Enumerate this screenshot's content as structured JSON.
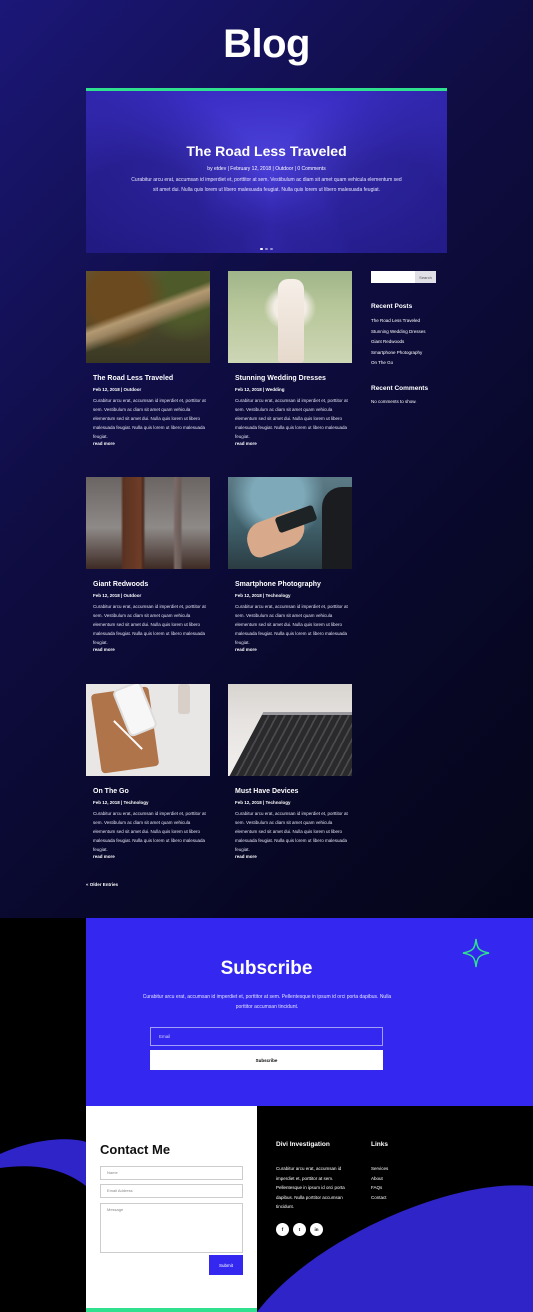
{
  "page": {
    "title": "Blog"
  },
  "slider": {
    "title": "The Road Less Traveled",
    "meta": "by etdev | February 12, 2018 | Outdoor | 0 Comments",
    "excerpt": "Curabitur arcu erat, accumsan id imperdiet et, porttitor at sem. Vestibulum ac diam sit amet quam vehicula elementum sed sit amet dui. Nulla quis lorem ut libero malesuada feugiat. Nulla quis lorem ut libero malesuada feugiat.",
    "dots": 3,
    "active_dot": 1
  },
  "posts": [
    {
      "title": "The Road Less Traveled",
      "meta": "Feb 12, 2018 | Outdoor",
      "excerpt": "Curabitur arcu erat, accumsan id imperdiet et, porttitor at sem. Vestibulum ac diam sit amet quam vehicula elementum sed sit amet dui. Nulla quis lorem ut libero malesuada feugiat. Nulla quis lorem ut libero malesuada feugiat.",
      "read_more": "read more"
    },
    {
      "title": "Stunning Wedding Dresses",
      "meta": "Feb 12, 2018 | Wedding",
      "excerpt": "Curabitur arcu erat, accumsan id imperdiet et, porttitor at sem. Vestibulum ac diam sit amet quam vehicula elementum sed sit amet dui. Nulla quis lorem ut libero malesuada feugiat. Nulla quis lorem ut libero malesuada feugiat.",
      "read_more": "read more"
    },
    {
      "title": "Giant Redwoods",
      "meta": "Feb 12, 2018 | Outdoor",
      "excerpt": "Curabitur arcu erat, accumsan id imperdiet et, porttitor at sem. Vestibulum ac diam sit amet quam vehicula elementum sed sit amet dui. Nulla quis lorem ut libero malesuada feugiat. Nulla quis lorem ut libero malesuada feugiat.",
      "read_more": "read more"
    },
    {
      "title": "Smartphone Photography",
      "meta": "Feb 12, 2018 | Technology",
      "excerpt": "Curabitur arcu erat, accumsan id imperdiet et, porttitor at sem. Vestibulum ac diam sit amet quam vehicula elementum sed sit amet dui. Nulla quis lorem ut libero malesuada feugiat. Nulla quis lorem ut libero malesuada feugiat.",
      "read_more": "read more"
    },
    {
      "title": "On The Go",
      "meta": "Feb 12, 2018 | Technology",
      "excerpt": "Curabitur arcu erat, accumsan id imperdiet et, porttitor at sem. Vestibulum ac diam sit amet quam vehicula elementum sed sit amet dui. Nulla quis lorem ut libero malesuada feugiat. Nulla quis lorem ut libero malesuada feugiat.",
      "read_more": "read more"
    },
    {
      "title": "Must Have Devices",
      "meta": "Feb 12, 2018 | Technology",
      "excerpt": "Curabitur arcu erat, accumsan id imperdiet et, porttitor at sem. Vestibulum ac diam sit amet quam vehicula elementum sed sit amet dui. Nulla quis lorem ut libero malesuada feugiat. Nulla quis lorem ut libero malesuada feugiat.",
      "read_more": "read more"
    }
  ],
  "sidebar": {
    "search_button": "Search",
    "recent_posts_title": "Recent Posts",
    "recent_posts": [
      "The Road Less Traveled",
      "Stunning Wedding Dresses",
      "Giant Redwoods",
      "Smartphone Photography",
      "On The Go"
    ],
    "recent_comments_title": "Recent Comments",
    "recent_comments_text": "No comments to show."
  },
  "pagination": {
    "older": "« Older Entries"
  },
  "subscribe": {
    "title": "Subscribe",
    "text": "Curabitur arcu erat, accumsan id imperdiet et, porttitor at sem. Pellentesque in ipsum id orci porta dapibus. Nulla porttitor accumsan tincidunt.",
    "email_placeholder": "Email",
    "button": "Subscribe"
  },
  "contact": {
    "title": "Contact Me",
    "name_placeholder": "Name",
    "email_placeholder": "Email Address",
    "message_placeholder": "Message",
    "submit": "Submit"
  },
  "footer": {
    "about_title": "Divi Investigation",
    "about_text": "Curabitur arcu erat, accumsan id imperdiet et, porttitor at sem. Pellentesque in ipsum id orci porta dapibus. Nulla porttitor accumsan tincidunt.",
    "social": [
      "f",
      "t",
      "in"
    ],
    "links_title": "Links",
    "links": [
      "Services",
      "About",
      "FAQs",
      "Contact"
    ]
  },
  "colors": {
    "accent_green": "#2fe08f",
    "accent_blue": "#3428f0",
    "hero_dark": "#0f0d43"
  }
}
